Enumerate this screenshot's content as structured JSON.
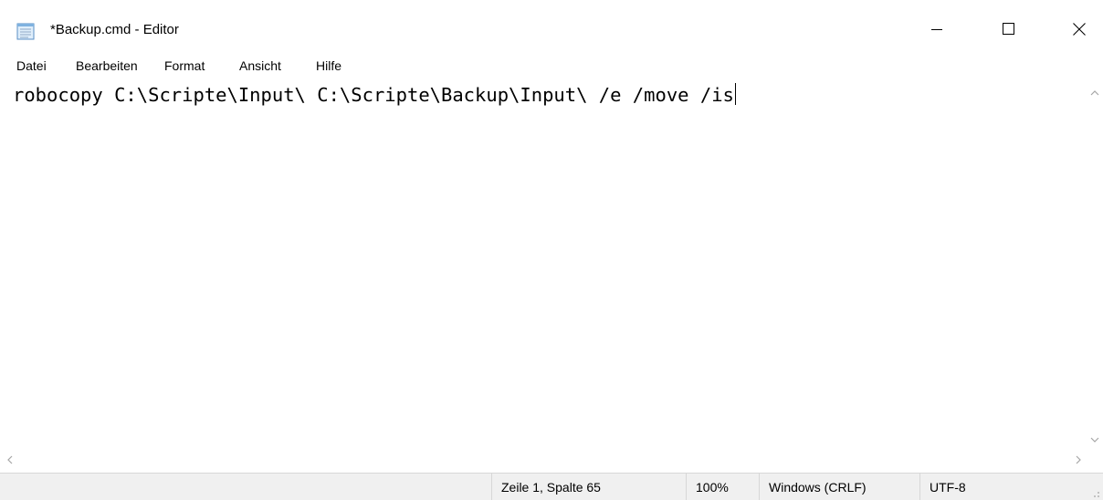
{
  "window": {
    "title": "*Backup.cmd - Editor",
    "icon": "notepad-icon",
    "controls": {
      "minimize_icon": "minimize-icon",
      "maximize_icon": "maximize-icon",
      "close_icon": "close-icon"
    }
  },
  "menu": {
    "items": [
      "Datei",
      "Bearbeiten",
      "Format",
      "Ansicht",
      "Hilfe"
    ]
  },
  "editor": {
    "content": "robocopy C:\\Scripte\\Input\\ C:\\Scripte\\Backup\\Input\\ /e /move /is"
  },
  "statusbar": {
    "position": "Zeile 1, Spalte 65",
    "zoom": "100%",
    "line_ending": "Windows (CRLF)",
    "encoding": "UTF-8"
  },
  "colors": {
    "background": "#ffffff",
    "statusbar_bg": "#f0f0f0",
    "text": "#000000",
    "scroll_arrow": "#a6a6a6"
  }
}
